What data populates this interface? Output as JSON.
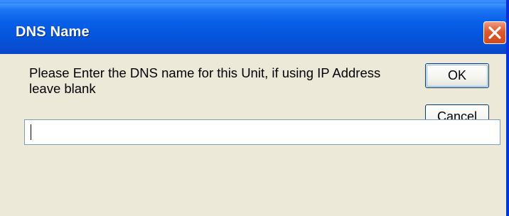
{
  "window": {
    "title": "DNS Name",
    "close_icon": "close-icon"
  },
  "dialog": {
    "prompt": "Please Enter the DNS name for this Unit, if using IP Address leave blank",
    "ok_label": "OK",
    "cancel_label": "Cancel",
    "dns_input": {
      "value": "",
      "placeholder": ""
    }
  },
  "colors": {
    "titlebar": "#0860e8",
    "dialog_background": "#ece9d8",
    "close_button": "#e0582e",
    "button_border": "#003c74"
  }
}
